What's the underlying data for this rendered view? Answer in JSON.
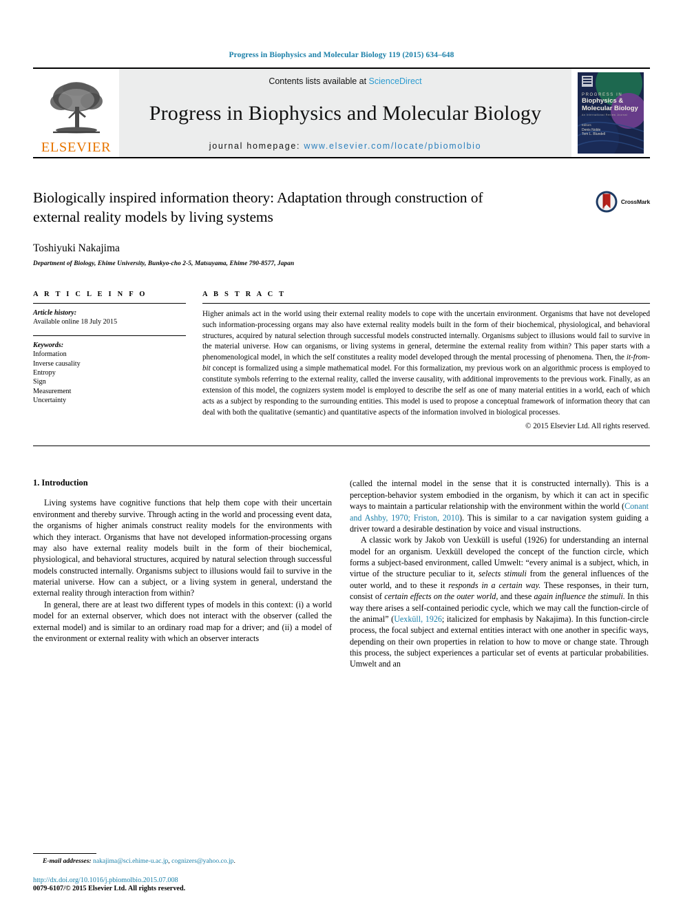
{
  "running_head": "Progress in Biophysics and Molecular Biology 119 (2015) 634–648",
  "masthead": {
    "publisher_name": "ELSEVIER",
    "contents_prefix": "Contents lists available at ",
    "sciencedirect": "ScienceDirect",
    "journal_name": "Progress in Biophysics and Molecular Biology",
    "homepage_prefix": "journal homepage: ",
    "homepage_url": "www.elsevier.com/locate/pbiomolbio",
    "cover_line1": "PROGRESS IN",
    "cover_line2": "Biophysics &",
    "cover_line3": "Molecular Biology",
    "cover_sub": "An International Review Journal",
    "cover_editors_label": "Editors",
    "cover_editor1": "Denis Noble",
    "cover_editor2": "Tom L. Blundell"
  },
  "title": "Biologically inspired information theory: Adaptation through construction of external reality models by living systems",
  "crossmark_label": "CrossMark",
  "author": "Toshiyuki Nakajima",
  "affiliation": "Department of Biology, Ehime University, Bunkyo-cho 2-5, Matsuyama, Ehime 790-8577, Japan",
  "article_info": {
    "heading": "A R T I C L E    I N F O",
    "history_label": "Article history:",
    "history_value": "Available online 18 July 2015",
    "keywords_label": "Keywords:",
    "keywords": [
      "Information",
      "Inverse causality",
      "Entropy",
      "Sign",
      "Measurement",
      "Uncertainty"
    ]
  },
  "abstract": {
    "heading": "A B S T R A C T",
    "part1": "Higher animals act in the world using their external reality models to cope with the uncertain environment. Organisms that have not developed such information-processing organs may also have external reality models built in the form of their biochemical, physiological, and behavioral structures, acquired by natural selection through successful models constructed internally. Organisms subject to illusions would fail to survive in the material universe. How can organisms, or living systems in general, determine the external reality from within? This paper starts with a phenomenological model, in which the self constitutes a reality model developed through the mental processing of phenomena. Then, the ",
    "italic1": "it-from-bit",
    "part2": " concept is formalized using a simple mathematical model. For this formalization, my previous work on an algorithmic process is employed to constitute symbols referring to the external reality, called the inverse causality, with additional improvements to the previous work. Finally, as an extension of this model, the cognizers system model is employed to describe the self as one of many material entities in a world, each of which acts as a subject by responding to the surrounding entities. This model is used to propose a conceptual framework of information theory that can deal with both the qualitative (semantic) and quantitative aspects of the information involved in biological processes.",
    "copyright": "© 2015 Elsevier Ltd. All rights reserved."
  },
  "body": {
    "section_number_title": "1. Introduction",
    "left_para1": "Living systems have cognitive functions that help them cope with their uncertain environment and thereby survive. Through acting in the world and processing event data, the organisms of higher animals construct reality models for the environments with which they interact. Organisms that have not developed information-processing organs may also have external reality models built in the form of their biochemical, physiological, and behavioral structures, acquired by natural selection through successful models constructed internally. Organisms subject to illusions would fail to survive in the material universe. How can a subject, or a living system in general, understand the external reality through interaction from within?",
    "left_para2": "In general, there are at least two different types of models in this context: (i) a world model for an external observer, which does not interact with the observer (called the external model) and is similar to an ordinary road map for a driver; and (ii) a model of the environment or external reality with which an observer interacts",
    "right_para1_a": "(called the internal model in the sense that it is constructed internally). This is a perception-behavior system embodied in the organism, by which it can act in specific ways to maintain a particular relationship with the environment within the world (",
    "right_para1_cite": "Conant and Ashby, 1970; Friston, 2010",
    "right_para1_b": "). This is similar to a car navigation system guiding a driver toward a desirable destination by voice and visual instructions.",
    "right_para2_a": "A classic work by Jakob von Uexküll is useful (1926) for understanding an internal model for an organism. Uexküll developed the concept of the function circle, which forms a subject-based environment, called Umwelt: “every animal is a subject, which, in virtue of the structure peculiar to it, ",
    "right_para2_it1": "selects stimuli",
    "right_para2_b": " from the general influences of the outer world, and to these it ",
    "right_para2_it2": "responds in a certain way.",
    "right_para2_c": " These responses, in their turn, consist of ",
    "right_para2_it3": "certain effects on the outer world,",
    "right_para2_d": " and these ",
    "right_para2_it4": "again influence the stimuli.",
    "right_para2_e": " In this way there arises a self-contained periodic cycle, which we may call the function-circle of the animal” (",
    "right_para2_cite": "Uexküll, 1926",
    "right_para2_f": "; italicized for emphasis by Nakajima). In this function-circle process, the focal subject and external entities interact with one another in specific ways, depending on their own properties in relation to how to move or change state. Through this process, the subject experiences a particular set of events at particular probabilities. Umwelt and an"
  },
  "footer": {
    "email_label": "E-mail addresses:",
    "email1": "nakajima@sci.ehime-u.ac.jp",
    "email_sep": ", ",
    "email2": "cognizers@yahoo.co.jp",
    "email_end": ".",
    "doi": "http://dx.doi.org/10.1016/j.pbiomolbio.2015.07.008",
    "issn_copyright": "0079-6107/© 2015 Elsevier Ltd. All rights reserved."
  },
  "colors": {
    "link_blue": "#1a7fa8",
    "sciencedirect_blue": "#2b9bd0",
    "elsevier_orange": "#e77500",
    "masthead_gray": "#eceded",
    "crossmark_red": "#b5211b",
    "crossmark_navy": "#1d3a63"
  }
}
